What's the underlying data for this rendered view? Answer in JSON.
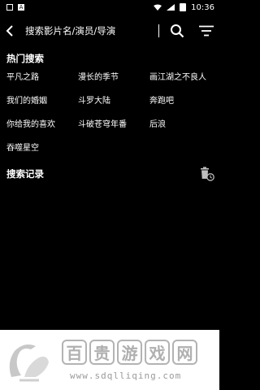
{
  "status_bar": {
    "time": "10:36",
    "notification_letter": "A"
  },
  "search": {
    "placeholder": "搜索影片名/演员/导演"
  },
  "hot_search": {
    "title": "热门搜索",
    "items": [
      "平凡之路",
      "漫长的季节",
      "画江湖之不良人",
      "我们的婚姻",
      "斗罗大陆",
      "奔跑吧",
      "你给我的喜欢",
      "斗破苍穹年番",
      "后浪",
      "吞噬星空"
    ]
  },
  "history": {
    "title": "搜索记录"
  },
  "ad_banner": {
    "characters": [
      "百",
      "贵",
      "游",
      "戏",
      "网"
    ],
    "url": "www.sdqlliqing.com"
  },
  "icons": {
    "back": "back-arrow-icon",
    "search": "search-icon",
    "filter": "filter-icon",
    "trash": "trash-clock-icon"
  }
}
